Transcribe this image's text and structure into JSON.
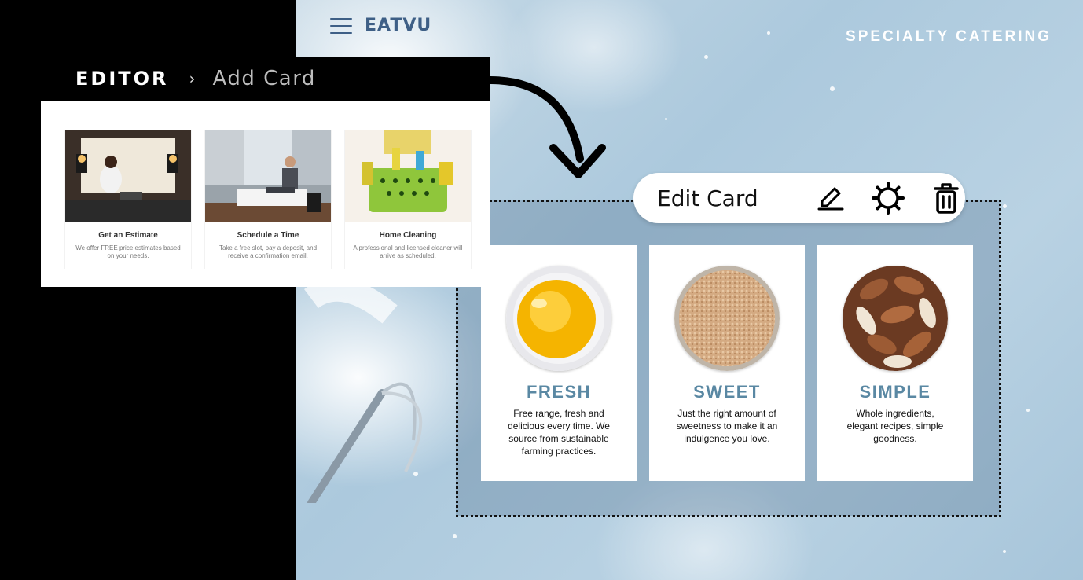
{
  "site": {
    "logo": "EATVU",
    "tagline": "SPECIALTY CATERING"
  },
  "editor": {
    "title": "EDITOR",
    "breadcrumb": "Add Card",
    "service_cards": [
      {
        "title": "Get an Estimate",
        "text": "We offer FREE price estimates based on your needs."
      },
      {
        "title": "Schedule a Time",
        "text": "Take a free slot, pay a deposit, and receive a confirmation email."
      },
      {
        "title": "Home Cleaning",
        "text": "A professional and licensed cleaner will arrive as scheduled."
      }
    ]
  },
  "toolbar": {
    "title": "Edit Card",
    "edit_icon": "edit-icon",
    "settings_icon": "gear-icon",
    "delete_icon": "trash-icon"
  },
  "cards": [
    {
      "title": "FRESH",
      "text": "Free range, fresh and delicious every time. We source from sustainable farming practices.",
      "image": "egg-yolk"
    },
    {
      "title": "SWEET",
      "text": "Just the right amount of sweetness to make it an indulgence you love.",
      "image": "brown-sugar"
    },
    {
      "title": "SIMPLE",
      "text": "Whole ingredients, elegant recipes, simple goodness.",
      "image": "almonds"
    }
  ],
  "colors": {
    "accent": "#5a88a3",
    "logo": "#3e5f86",
    "background": "#000000"
  }
}
